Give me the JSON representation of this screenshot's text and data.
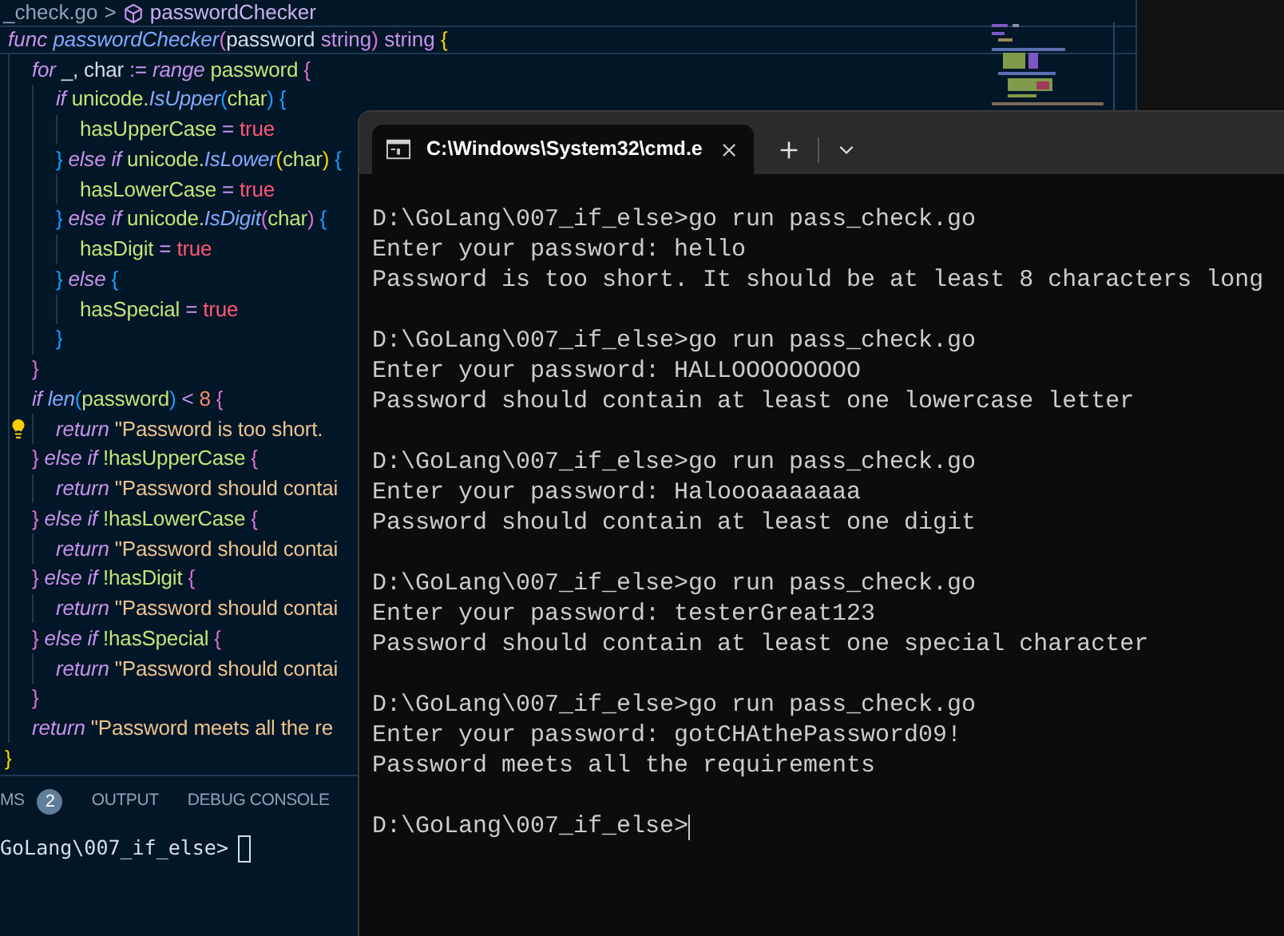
{
  "editor": {
    "breadcrumb": {
      "file": "_check.go",
      "separator": ">",
      "symbol": "passwordChecker"
    },
    "sticky_line": [
      {
        "kind": "kw",
        "text": "func "
      },
      {
        "kind": "fn",
        "text": "passwordChecker"
      },
      {
        "kind": "b2",
        "text": "("
      },
      {
        "kind": "plain",
        "text": "password "
      },
      {
        "kind": "type",
        "text": "string"
      },
      {
        "kind": "b2",
        "text": ")"
      },
      {
        "kind": "type",
        "text": " string"
      },
      {
        "kind": "b1",
        "text": " {"
      }
    ],
    "body": [
      {
        "lightbulb": false,
        "tokens": [
          {
            "kind": "kw",
            "text": "for"
          },
          {
            "kind": "plain",
            "text": " _, char "
          },
          {
            "kind": "op",
            "text": ":= "
          },
          {
            "kind": "kw",
            "text": "range"
          },
          {
            "kind": "id",
            "text": " password"
          },
          {
            "kind": "b2",
            "text": " {"
          }
        ],
        "children": [
          {
            "lightbulb": false,
            "tokens": [
              {
                "kind": "kw",
                "text": "if"
              },
              {
                "kind": "id",
                "text": " unicode."
              },
              {
                "kind": "fn",
                "text": "IsUpper"
              },
              {
                "kind": "b3",
                "text": "("
              },
              {
                "kind": "id",
                "text": "char"
              },
              {
                "kind": "b3",
                "text": ")"
              },
              {
                "kind": "b3",
                "text": " {"
              }
            ],
            "children": [
              {
                "lightbulb": false,
                "tokens": [
                  {
                    "kind": "id",
                    "text": "hasUpperCase"
                  },
                  {
                    "kind": "op",
                    "text": " = "
                  },
                  {
                    "kind": "bool",
                    "text": "true"
                  }
                ]
              }
            ]
          },
          {
            "lightbulb": false,
            "tokens": [
              {
                "kind": "b3",
                "text": "}"
              },
              {
                "kind": "kw",
                "text": " else if"
              },
              {
                "kind": "id",
                "text": " unicode."
              },
              {
                "kind": "fn",
                "text": "IsLower"
              },
              {
                "kind": "b1",
                "text": "("
              },
              {
                "kind": "id",
                "text": "char"
              },
              {
                "kind": "b1",
                "text": ")"
              },
              {
                "kind": "b3",
                "text": " {"
              }
            ],
            "children": [
              {
                "lightbulb": false,
                "tokens": [
                  {
                    "kind": "id",
                    "text": "hasLowerCase"
                  },
                  {
                    "kind": "op",
                    "text": " = "
                  },
                  {
                    "kind": "bool",
                    "text": "true"
                  }
                ]
              }
            ]
          },
          {
            "lightbulb": false,
            "tokens": [
              {
                "kind": "b3",
                "text": "}"
              },
              {
                "kind": "kw",
                "text": " else if"
              },
              {
                "kind": "id",
                "text": " unicode."
              },
              {
                "kind": "fn",
                "text": "IsDigit"
              },
              {
                "kind": "b2",
                "text": "("
              },
              {
                "kind": "id",
                "text": "char"
              },
              {
                "kind": "b2",
                "text": ")"
              },
              {
                "kind": "b3",
                "text": " {"
              }
            ],
            "children": [
              {
                "lightbulb": false,
                "tokens": [
                  {
                    "kind": "id",
                    "text": "hasDigit"
                  },
                  {
                    "kind": "op",
                    "text": " = "
                  },
                  {
                    "kind": "bool",
                    "text": "true"
                  }
                ]
              }
            ]
          },
          {
            "lightbulb": false,
            "tokens": [
              {
                "kind": "b3",
                "text": "}"
              },
              {
                "kind": "kw",
                "text": " else"
              },
              {
                "kind": "b3",
                "text": " {"
              }
            ],
            "children": [
              {
                "lightbulb": false,
                "tokens": [
                  {
                    "kind": "id",
                    "text": "hasSpecial"
                  },
                  {
                    "kind": "op",
                    "text": " = "
                  },
                  {
                    "kind": "bool",
                    "text": "true"
                  }
                ]
              }
            ]
          },
          {
            "lightbulb": false,
            "tokens": [
              {
                "kind": "b3",
                "text": "}"
              }
            ]
          }
        ]
      },
      {
        "lightbulb": false,
        "tokens": [
          {
            "kind": "b2",
            "text": "}"
          }
        ]
      },
      {
        "lightbulb": false,
        "tokens": [
          {
            "kind": "kw",
            "text": "if"
          },
          {
            "kind": "fn",
            "text": " len"
          },
          {
            "kind": "b3",
            "text": "("
          },
          {
            "kind": "id",
            "text": "password"
          },
          {
            "kind": "b3",
            "text": ")"
          },
          {
            "kind": "op",
            "text": " < "
          },
          {
            "kind": "num",
            "text": "8"
          },
          {
            "kind": "b2",
            "text": " {"
          }
        ],
        "children": [
          {
            "lightbulb": true,
            "tokens": [
              {
                "kind": "kw",
                "text": "return"
              },
              {
                "kind": "str",
                "text": " \"Password is too short."
              }
            ]
          }
        ]
      },
      {
        "lightbulb": false,
        "tokens": [
          {
            "kind": "b2",
            "text": "}"
          },
          {
            "kind": "kw",
            "text": " else if"
          },
          {
            "kind": "id",
            "text": " !hasUpperCase"
          },
          {
            "kind": "b2",
            "text": " {"
          }
        ],
        "children": [
          {
            "lightbulb": false,
            "tokens": [
              {
                "kind": "kw",
                "text": "return"
              },
              {
                "kind": "str",
                "text": " \"Password should contai"
              }
            ]
          }
        ]
      },
      {
        "lightbulb": false,
        "tokens": [
          {
            "kind": "b2",
            "text": "}"
          },
          {
            "kind": "kw",
            "text": " else if"
          },
          {
            "kind": "id",
            "text": " !hasLowerCase"
          },
          {
            "kind": "b2",
            "text": " {"
          }
        ],
        "children": [
          {
            "lightbulb": false,
            "tokens": [
              {
                "kind": "kw",
                "text": "return"
              },
              {
                "kind": "str",
                "text": " \"Password should contai"
              }
            ]
          }
        ]
      },
      {
        "lightbulb": false,
        "tokens": [
          {
            "kind": "b2",
            "text": "}"
          },
          {
            "kind": "kw",
            "text": " else if"
          },
          {
            "kind": "id",
            "text": " !hasDigit"
          },
          {
            "kind": "b2",
            "text": " {"
          }
        ],
        "children": [
          {
            "lightbulb": false,
            "tokens": [
              {
                "kind": "kw",
                "text": "return"
              },
              {
                "kind": "str",
                "text": " \"Password should contai"
              }
            ]
          }
        ]
      },
      {
        "lightbulb": false,
        "tokens": [
          {
            "kind": "b2",
            "text": "}"
          },
          {
            "kind": "kw",
            "text": " else if"
          },
          {
            "kind": "id",
            "text": " !hasSpecial"
          },
          {
            "kind": "b2",
            "text": " {"
          }
        ],
        "children": [
          {
            "lightbulb": false,
            "tokens": [
              {
                "kind": "kw",
                "text": "return"
              },
              {
                "kind": "str",
                "text": " \"Password should contai"
              }
            ]
          }
        ]
      },
      {
        "lightbulb": false,
        "tokens": [
          {
            "kind": "b2",
            "text": "}"
          }
        ]
      },
      {
        "lightbulb": false,
        "tokens": [
          {
            "kind": "kw",
            "text": "return"
          },
          {
            "kind": "str",
            "text": " \"Password meets all the re"
          }
        ]
      }
    ],
    "closing_line": [
      {
        "kind": "b1",
        "text": "}"
      }
    ]
  },
  "panel": {
    "tabs": [
      {
        "label": "MS",
        "badge": "2",
        "selected": false
      },
      {
        "label": "OUTPUT",
        "selected": false
      },
      {
        "label": "DEBUG CONSOLE",
        "selected": false
      }
    ],
    "terminal_line": "GoLang\\007_if_else>"
  },
  "terminal_window": {
    "tab_title": "C:\\Windows\\System32\\cmd.e",
    "output": [
      [
        "D:\\GoLang\\007_if_else>go run pass_check.go",
        "Enter your password: hello",
        "Password is too short. It should be at least 8 characters long"
      ],
      [
        "D:\\GoLang\\007_if_else>go run pass_check.go",
        "Enter your password: HALLOOOOOOOOO",
        "Password should contain at least one lowercase letter"
      ],
      [
        "D:\\GoLang\\007_if_else>go run pass_check.go",
        "Enter your password: Haloooaaaaaaa",
        "Password should contain at least one digit"
      ],
      [
        "D:\\GoLang\\007_if_else>go run pass_check.go",
        "Enter your password: testerGreat123",
        "Password should contain at least one special character"
      ],
      [
        "D:\\GoLang\\007_if_else>go run pass_check.go",
        "Enter your password: gotCHAthePassword09!",
        "Password meets all the requirements"
      ]
    ],
    "prompt": "D:\\GoLang\\007_if_else>"
  }
}
